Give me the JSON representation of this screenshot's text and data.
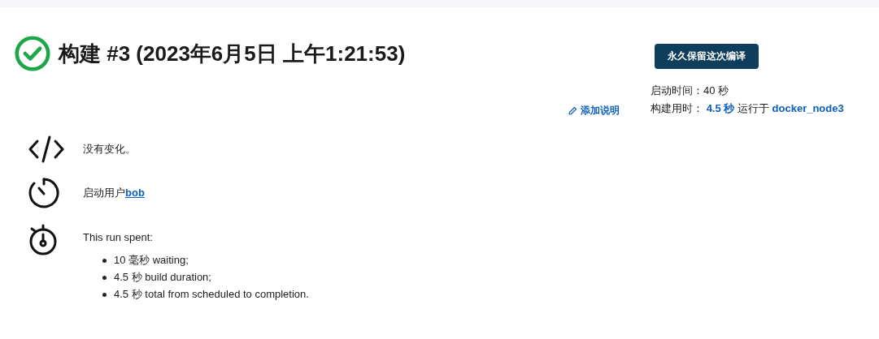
{
  "build": {
    "successful": true,
    "title": "构建 #3 (2023年6月5日 上午1:21:53)"
  },
  "keep_button": "永久保留这次编译",
  "add_description": "添加说明",
  "info": {
    "started_label": "启动时间：",
    "started_value": "40 秒",
    "duration_label": "构建用时：",
    "duration_value": "4.5 秒",
    "runs_on_label": "运行于",
    "node": "docker_node3"
  },
  "summary": [
    {
      "kind": "changes",
      "text": "没有变化。"
    },
    {
      "kind": "user",
      "text": "启动用户",
      "link": "bob"
    },
    {
      "kind": "timing",
      "text": "This run spent:",
      "items": [
        "10 毫秒 waiting;",
        "4.5 秒 build duration;",
        "4.5 秒 total from scheduled to completion."
      ]
    }
  ]
}
